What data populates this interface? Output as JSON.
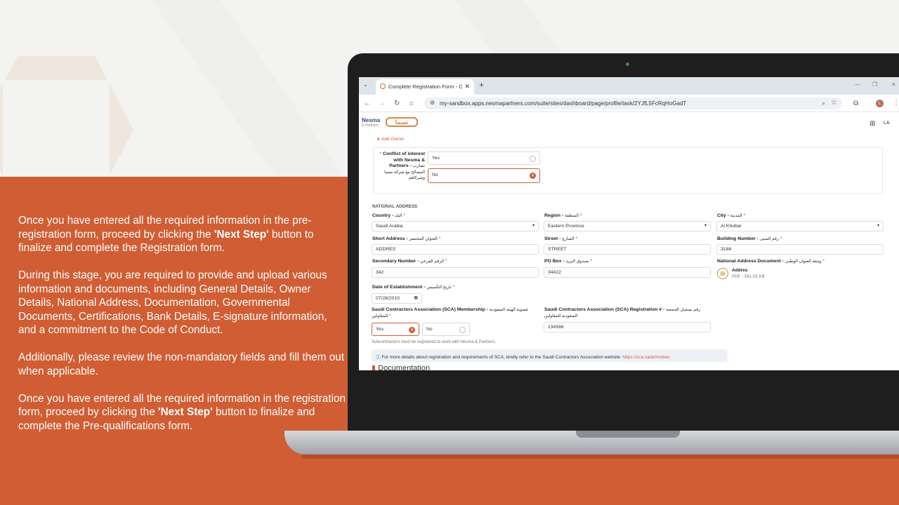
{
  "slide": {
    "paragraphs": [
      [
        "Once you have entered all the required information in the pre-registration form, proceed by clicking the ",
        "'Next Step'",
        " button to finalize and complete the Registration form."
      ],
      [
        "During this stage, you are required to provide and upload various information and documents, including General Details, Owner Details, National Address, Documentation, Governmental Documents, Certifications, Bank Details, E-signature information, and a commitment to the Code of Conduct.",
        "",
        ""
      ],
      [
        "Additionally, please review the non-mandatory fields and fill them out when applicable.",
        "",
        ""
      ],
      [
        "Once you have entered all the required information in the registration form, proceed by clicking the ",
        "'Next Step'",
        " button to finalize and complete the Pre-qualifications form."
      ]
    ]
  },
  "browser": {
    "tab_title": "Complete Registration Form - C",
    "url": "my-sandbox.apps.nesmapartners.com/suite/sites/dashboard/page/profile/task/2YJfL5FcRqHoGadT",
    "profile_initial": "L"
  },
  "app": {
    "logo_text": "Nesma",
    "logo_sub": "& Partners",
    "logo_ar": "نسما",
    "user_initials": "LA",
    "add_owner": "Add Owner",
    "conflict": {
      "label": "Conflict of interest with Nesma & Partners -",
      "label_ar": "تضارب المصالح مع شركة نسما وشركاهم",
      "options": [
        "Yes",
        "No"
      ],
      "selected": "No"
    },
    "national_address": {
      "heading": "NATIONAL ADDRESS",
      "country_label": "Country -",
      "country_ar": "البلد",
      "country_value": "Saudi Arabia",
      "region_label": "Region -",
      "region_ar": "المنطقة",
      "region_value": "Eastern Province",
      "city_label": "City -",
      "city_ar": "المدينة",
      "city_value": "Al Khobar",
      "short_label": "Short Address -",
      "short_ar": "العنوان المختصر",
      "short_value": "ADDRES",
      "street_label": "Street -",
      "street_ar": "الشارع",
      "street_value": "STREET",
      "building_label": "Building Number -",
      "building_ar": "رقم المبنى",
      "building_value": "3188",
      "secondary_label": "Secondary Number -",
      "secondary_ar": "الرقم الفرعي",
      "secondary_value": "342",
      "pobox_label": "PO Box -",
      "pobox_ar": "صندوق البريد",
      "pobox_value": "34422",
      "doc_label": "National Address Document -",
      "doc_ar": "وثيقة العنوان الوطني",
      "doc_name": "Addres",
      "doc_meta": "PDF - 581.05 KB",
      "date_label": "Date of Establishment -",
      "date_ar": "تاريخ التأسيس",
      "date_value": "07/28/2010"
    },
    "sca": {
      "membership_label": "Saudi Contractors Association (SCA) Membership -",
      "membership_ar": "عضوية الهيئة السعودية للمقاولين",
      "options": [
        "Yes",
        "No"
      ],
      "selected": "Yes",
      "registration_label": "Saudi Contractors Association (SCA) Registration # -",
      "registration_ar": "رقم تسجيل الجمعية السعودية للمقاولين",
      "registration_value": "234566",
      "note": "Subcontractors must be registered to work with Nesma & Partners.",
      "info_text": "For more details about registration and requirements of SCA, kindly refer to the Saudi Contractors Association website:",
      "info_link": "https://sca.sa/ar/msben"
    },
    "documentation_heading": "Documentation"
  },
  "colors": {
    "accent": "#d05d33",
    "selected_border": "#c8613a"
  }
}
